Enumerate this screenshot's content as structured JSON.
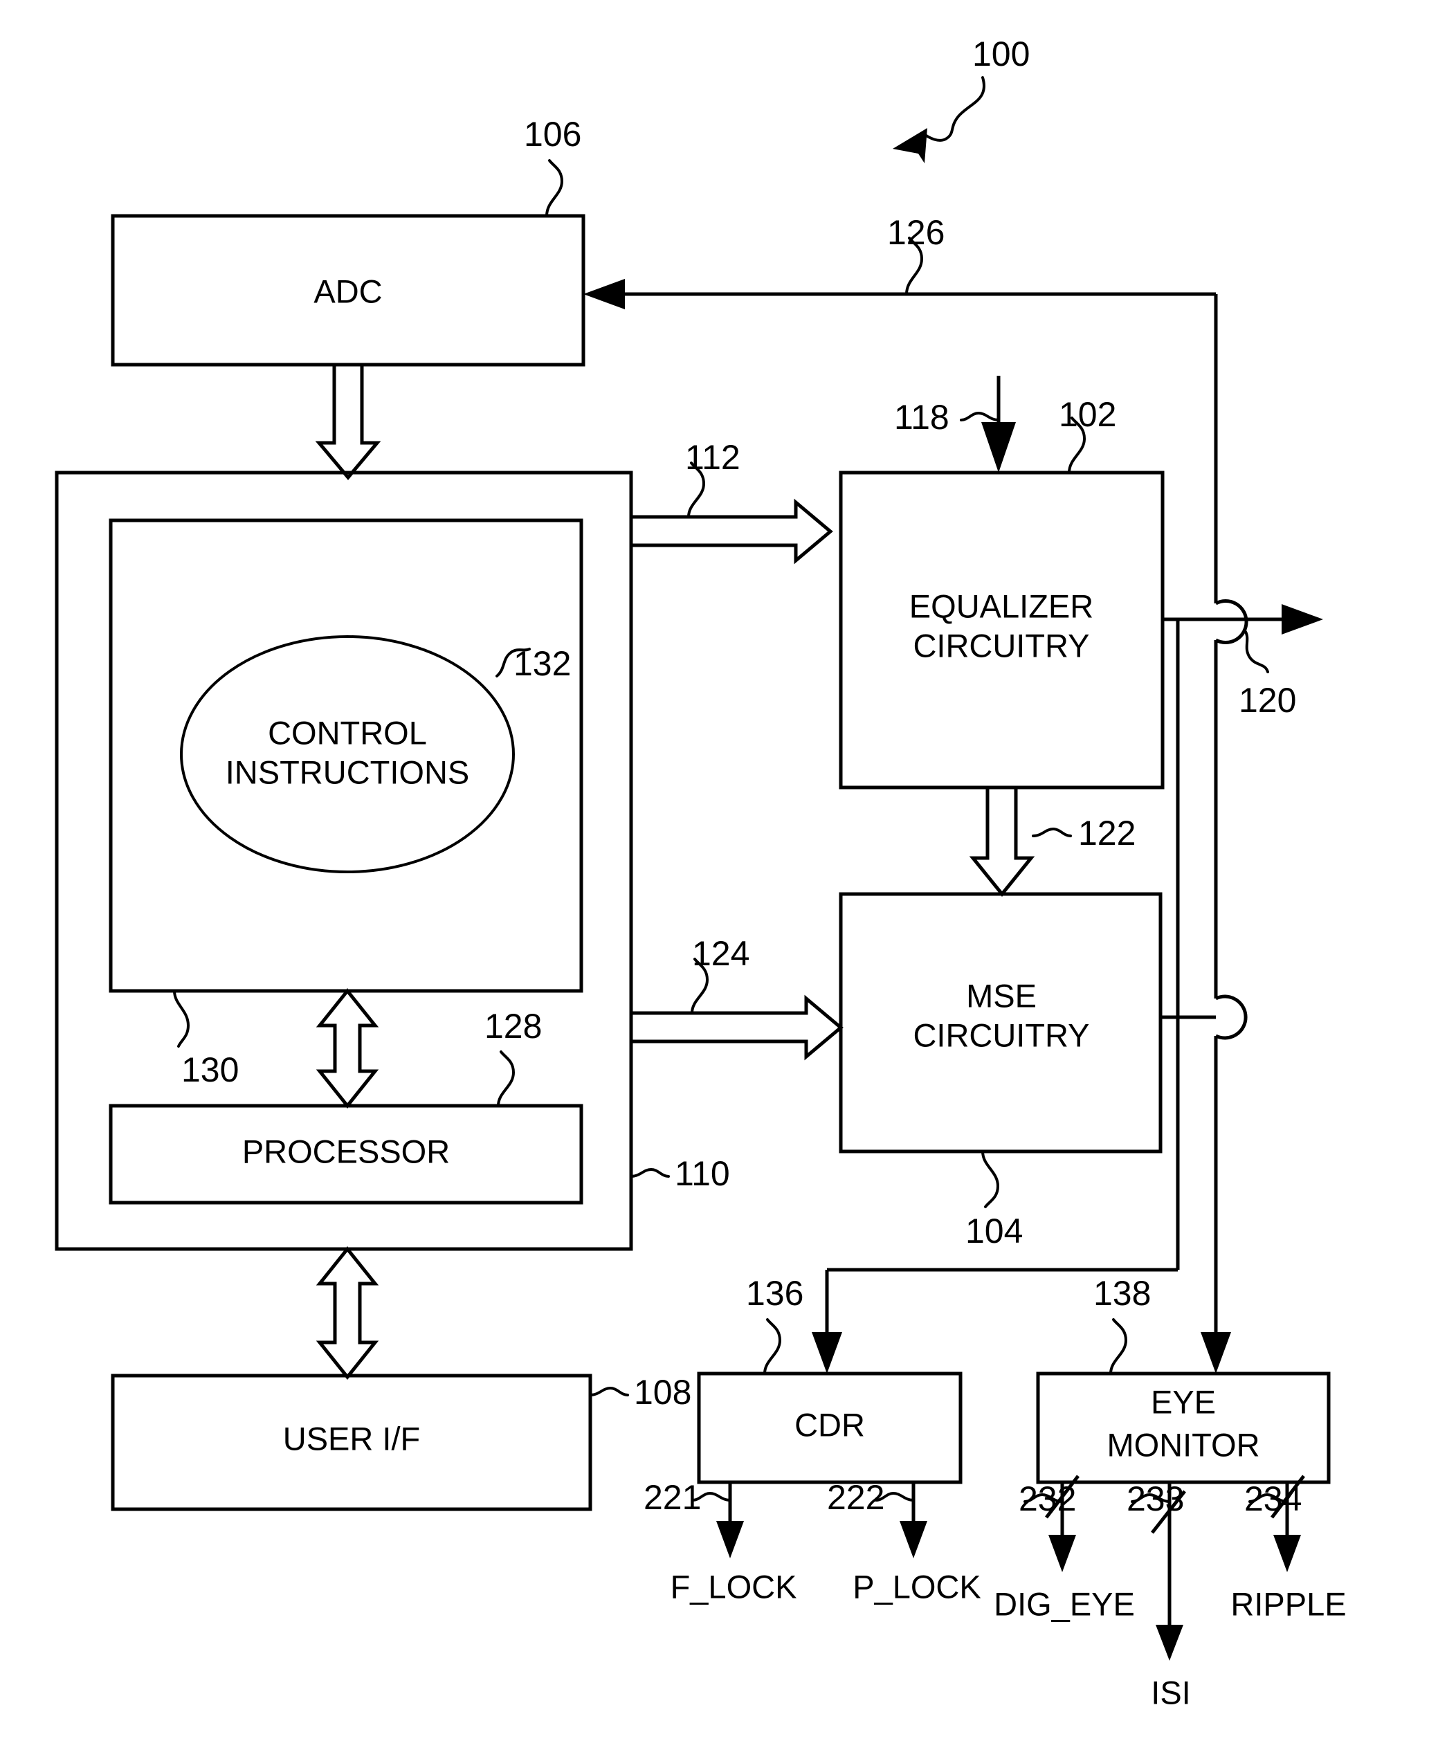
{
  "figure": {
    "type": "patent-block-diagram",
    "system_reference": "100",
    "blocks": [
      {
        "id": "adc",
        "label": "ADC",
        "ref": "106"
      },
      {
        "id": "controller",
        "label": "",
        "ref": "110"
      },
      {
        "id": "memory",
        "label": "",
        "ref": "130"
      },
      {
        "id": "control_instructions",
        "label_line1": "CONTROL",
        "label_line2": "INSTRUCTIONS",
        "ref": "132"
      },
      {
        "id": "processor",
        "label": "PROCESSOR",
        "ref": "128"
      },
      {
        "id": "user_if",
        "label": "USER I/F",
        "ref": "108"
      },
      {
        "id": "equalizer",
        "label_line1": "EQUALIZER",
        "label_line2": "CIRCUITRY",
        "ref": "102"
      },
      {
        "id": "mse",
        "label_line1": "MSE",
        "label_line2": "CIRCUITRY",
        "ref": "104"
      },
      {
        "id": "cdr",
        "label": "CDR",
        "ref": "136"
      },
      {
        "id": "eye_monitor",
        "label_line1": "EYE",
        "label_line2": "MONITOR",
        "ref": "138"
      }
    ],
    "signals": [
      {
        "ref": "112",
        "from": "controller",
        "to": "equalizer",
        "style": "hollow-bus"
      },
      {
        "ref": "124",
        "from": "controller",
        "to": "mse",
        "style": "hollow-bus"
      },
      {
        "ref": "118",
        "from": "external",
        "to": "equalizer",
        "style": "solid"
      },
      {
        "ref": "120",
        "from": "equalizer",
        "to": "output",
        "style": "solid"
      },
      {
        "ref": "122",
        "from": "equalizer",
        "to": "mse",
        "style": "hollow-bus"
      },
      {
        "ref": "126",
        "from": "equalizer-output",
        "to": "adc",
        "style": "solid"
      },
      {
        "ref": "221",
        "from": "cdr",
        "to": "F_LOCK",
        "style": "solid"
      },
      {
        "ref": "222",
        "from": "cdr",
        "to": "P_LOCK",
        "style": "solid"
      },
      {
        "ref": "232",
        "from": "eye_monitor",
        "to": "DIG_EYE",
        "style": "bus-slash"
      },
      {
        "ref": "233",
        "from": "eye_monitor",
        "to": "ISI",
        "style": "bus-slash"
      },
      {
        "ref": "234",
        "from": "eye_monitor",
        "to": "RIPPLE",
        "style": "bus-slash"
      }
    ],
    "outputs": [
      {
        "name": "F_LOCK"
      },
      {
        "name": "P_LOCK"
      },
      {
        "name": "DIG_EYE"
      },
      {
        "name": "ISI"
      },
      {
        "name": "RIPPLE"
      }
    ],
    "reference_numerals": {
      "system": "100",
      "equalizer": "102",
      "mse": "104",
      "adc": "106",
      "user_if": "108",
      "controller": "110",
      "ctrl_to_eq": "112",
      "eq_input": "118",
      "eq_output": "120",
      "eq_to_mse": "122",
      "ctrl_to_mse": "124",
      "feedback_to_adc": "126",
      "processor": "128",
      "memory": "130",
      "control_instructions": "132",
      "cdr": "136",
      "eye_monitor": "138",
      "f_lock_sig": "221",
      "p_lock_sig": "222",
      "dig_eye_sig": "232",
      "isi_sig": "233",
      "ripple_sig": "234"
    },
    "colors": {
      "stroke": "#000000",
      "background": "#ffffff"
    }
  }
}
